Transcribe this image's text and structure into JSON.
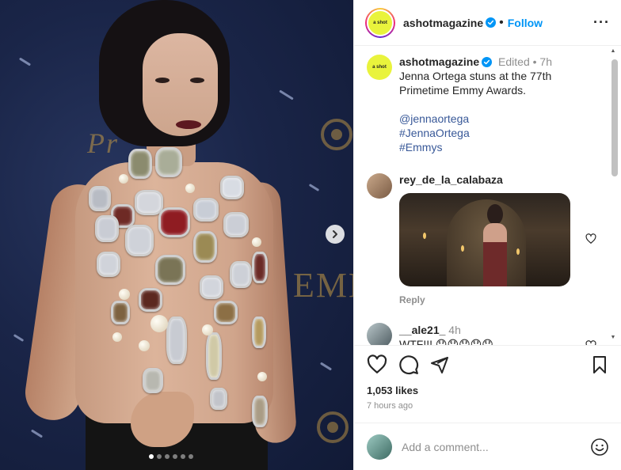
{
  "post": {
    "author": "ashotmagazine",
    "avatar_text": "a shot",
    "follow_label": "Follow",
    "more_icon": "more-horizontal-icon"
  },
  "caption": {
    "author": "ashotmagazine",
    "edited": "Edited",
    "age": "7h",
    "text": "Jenna Ortega stuns at the 77th Primetime Emmy Awards.",
    "mention": "@jennaortega",
    "hashtags": [
      "#JennaOrtega",
      "#Emmys"
    ]
  },
  "comments": [
    {
      "user": "rey_de_la_calabaza",
      "has_gif": true,
      "reply_label": "Reply"
    },
    {
      "user": "__ale21_",
      "age": "4h",
      "text": "WTF!!! 😯😯😯😯😯"
    }
  ],
  "engagement": {
    "likes": "1,053 likes",
    "time": "7 hours ago"
  },
  "composer": {
    "placeholder": "Add a comment..."
  },
  "carousel": {
    "slides": 6,
    "active": 0
  },
  "colors": {
    "follow": "#0095f6",
    "verified": "#0095f6",
    "link": "#385898"
  }
}
